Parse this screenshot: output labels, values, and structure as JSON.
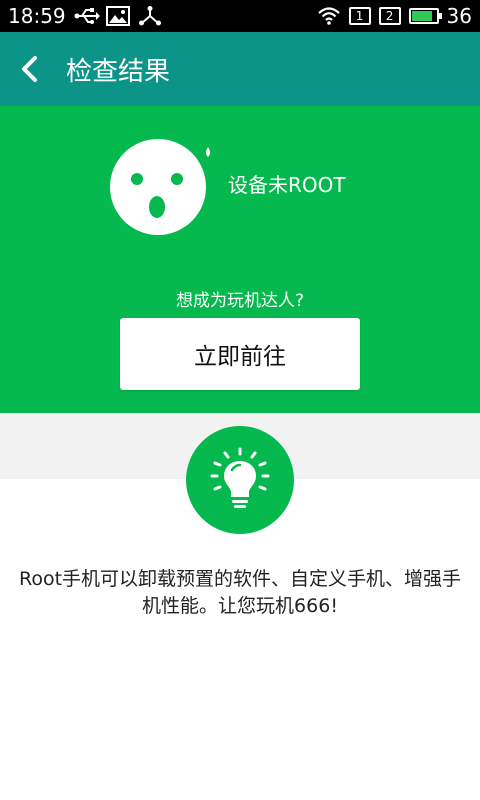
{
  "status_bar": {
    "time": "18:59",
    "sim1": "1",
    "sim2": "2",
    "battery_level": "36",
    "icons": [
      "usb-icon",
      "image-icon",
      "share-icon",
      "wifi-icon",
      "battery-icon"
    ]
  },
  "toolbar": {
    "title": "检查结果",
    "back_icon": "chevron-left-icon"
  },
  "hero": {
    "status": "设备未ROOT",
    "prompt": "想成为玩机达人?",
    "button_label": "立即前往",
    "face_icon": "surprised-face-icon"
  },
  "info": {
    "icon": "lightbulb-icon",
    "description": "Root手机可以卸载预置的软件、自定义手机、增强手机性能。让您玩机666!"
  },
  "colors": {
    "toolbar": "#0d9489",
    "hero": "#06b94e",
    "band": "#f2f2f2"
  }
}
